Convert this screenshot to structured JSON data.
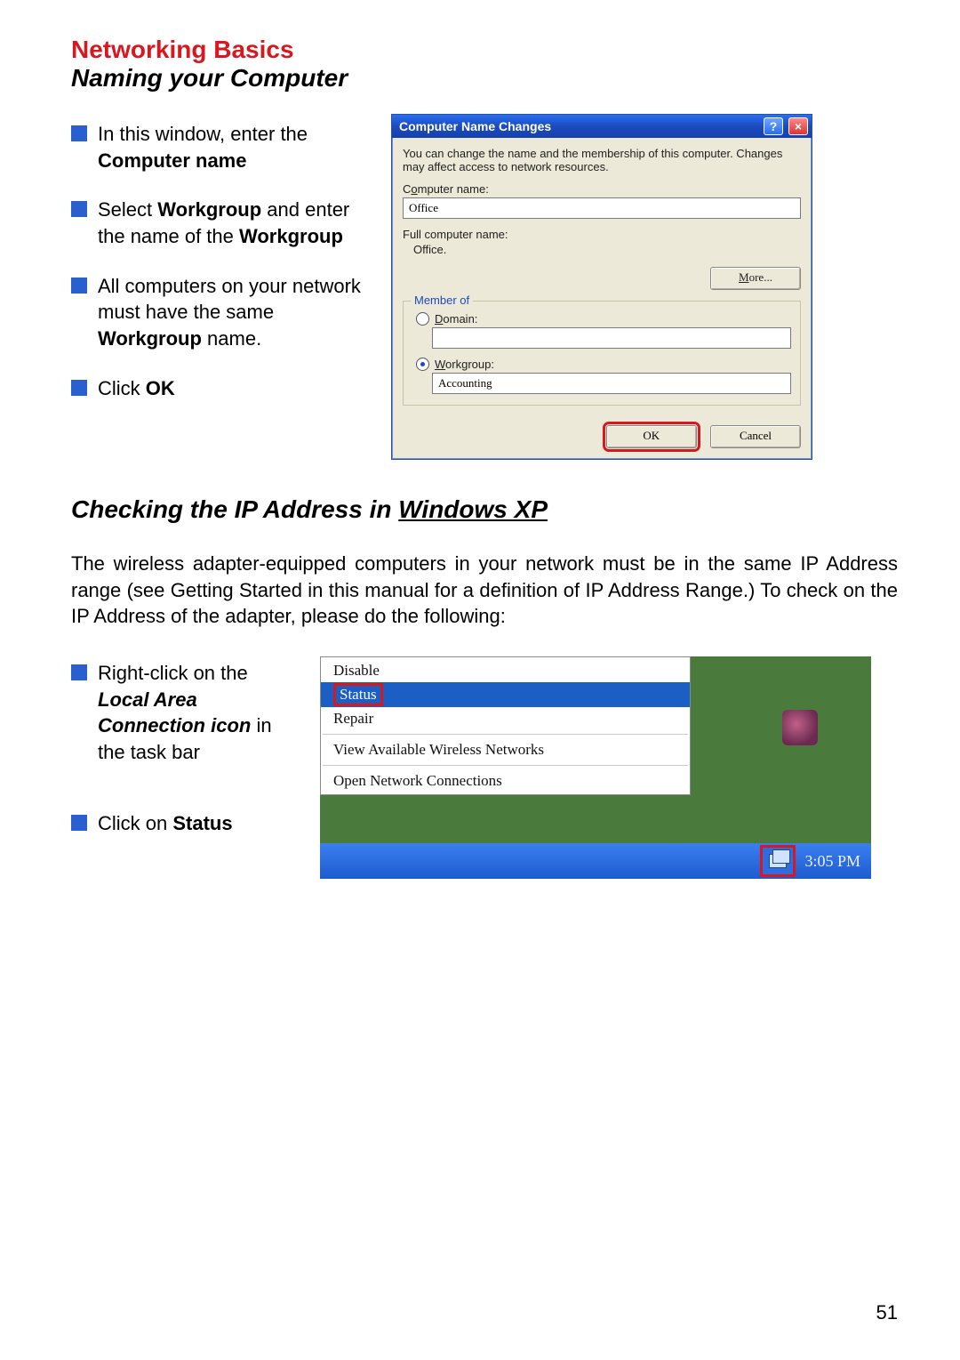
{
  "headings": {
    "section_title": "Networking Basics",
    "subtitle1": "Naming your Computer",
    "subtitle2_pre": "Checking the IP Address in ",
    "subtitle2_u": "Windows XP"
  },
  "bullets1": {
    "b1_pre": "In this window, enter the ",
    "b1_bold": "Computer name",
    "b2_pre": "Select ",
    "b2_bold1": "Workgroup",
    "b2_mid": " and enter the name of the ",
    "b2_bold2": "Workgroup",
    "b3_pre": "All computers on your network must have the same ",
    "b3_bold": "Workgroup",
    "b3_post": " name.",
    "b4_pre": "Click ",
    "b4_bold": "OK"
  },
  "dialog": {
    "title": "Computer Name Changes",
    "desc": "You can change the name and the membership of this computer. Changes may affect access to network resources.",
    "label_computer_name_pre": "C",
    "label_computer_name_u": "o",
    "label_computer_name_post": "mputer name:",
    "computer_name_value": "Office",
    "label_full": "Full computer name:",
    "full_value": "Office.",
    "more_u": "M",
    "more_post": "ore...",
    "fieldset_legend": "Member of",
    "radio_domain_u": "D",
    "radio_domain_post": "omain:",
    "radio_workgroup_u": "W",
    "radio_workgroup_post": "orkgroup:",
    "workgroup_value": "Accounting",
    "ok": "OK",
    "cancel": "Cancel"
  },
  "para": "The wireless adapter-equipped computers in your network must be in the same IP Address range (see Getting Started in this manual for a definition of IP Address Range.)  To check on the IP Address of the adapter, please do the following:",
  "bullets2": {
    "b1_pre": "Right-click on the ",
    "b1_bi": "Local Area Connection icon",
    "b1_post": " in the task bar",
    "b2_pre": "Click on ",
    "b2_bold": "Status"
  },
  "ctx": {
    "disable": "Disable",
    "status": "Status",
    "repair": "Repair",
    "view": "View Available Wireless Networks",
    "open": "Open Network Connections"
  },
  "clock": "3:05 PM",
  "page_number": "51"
}
